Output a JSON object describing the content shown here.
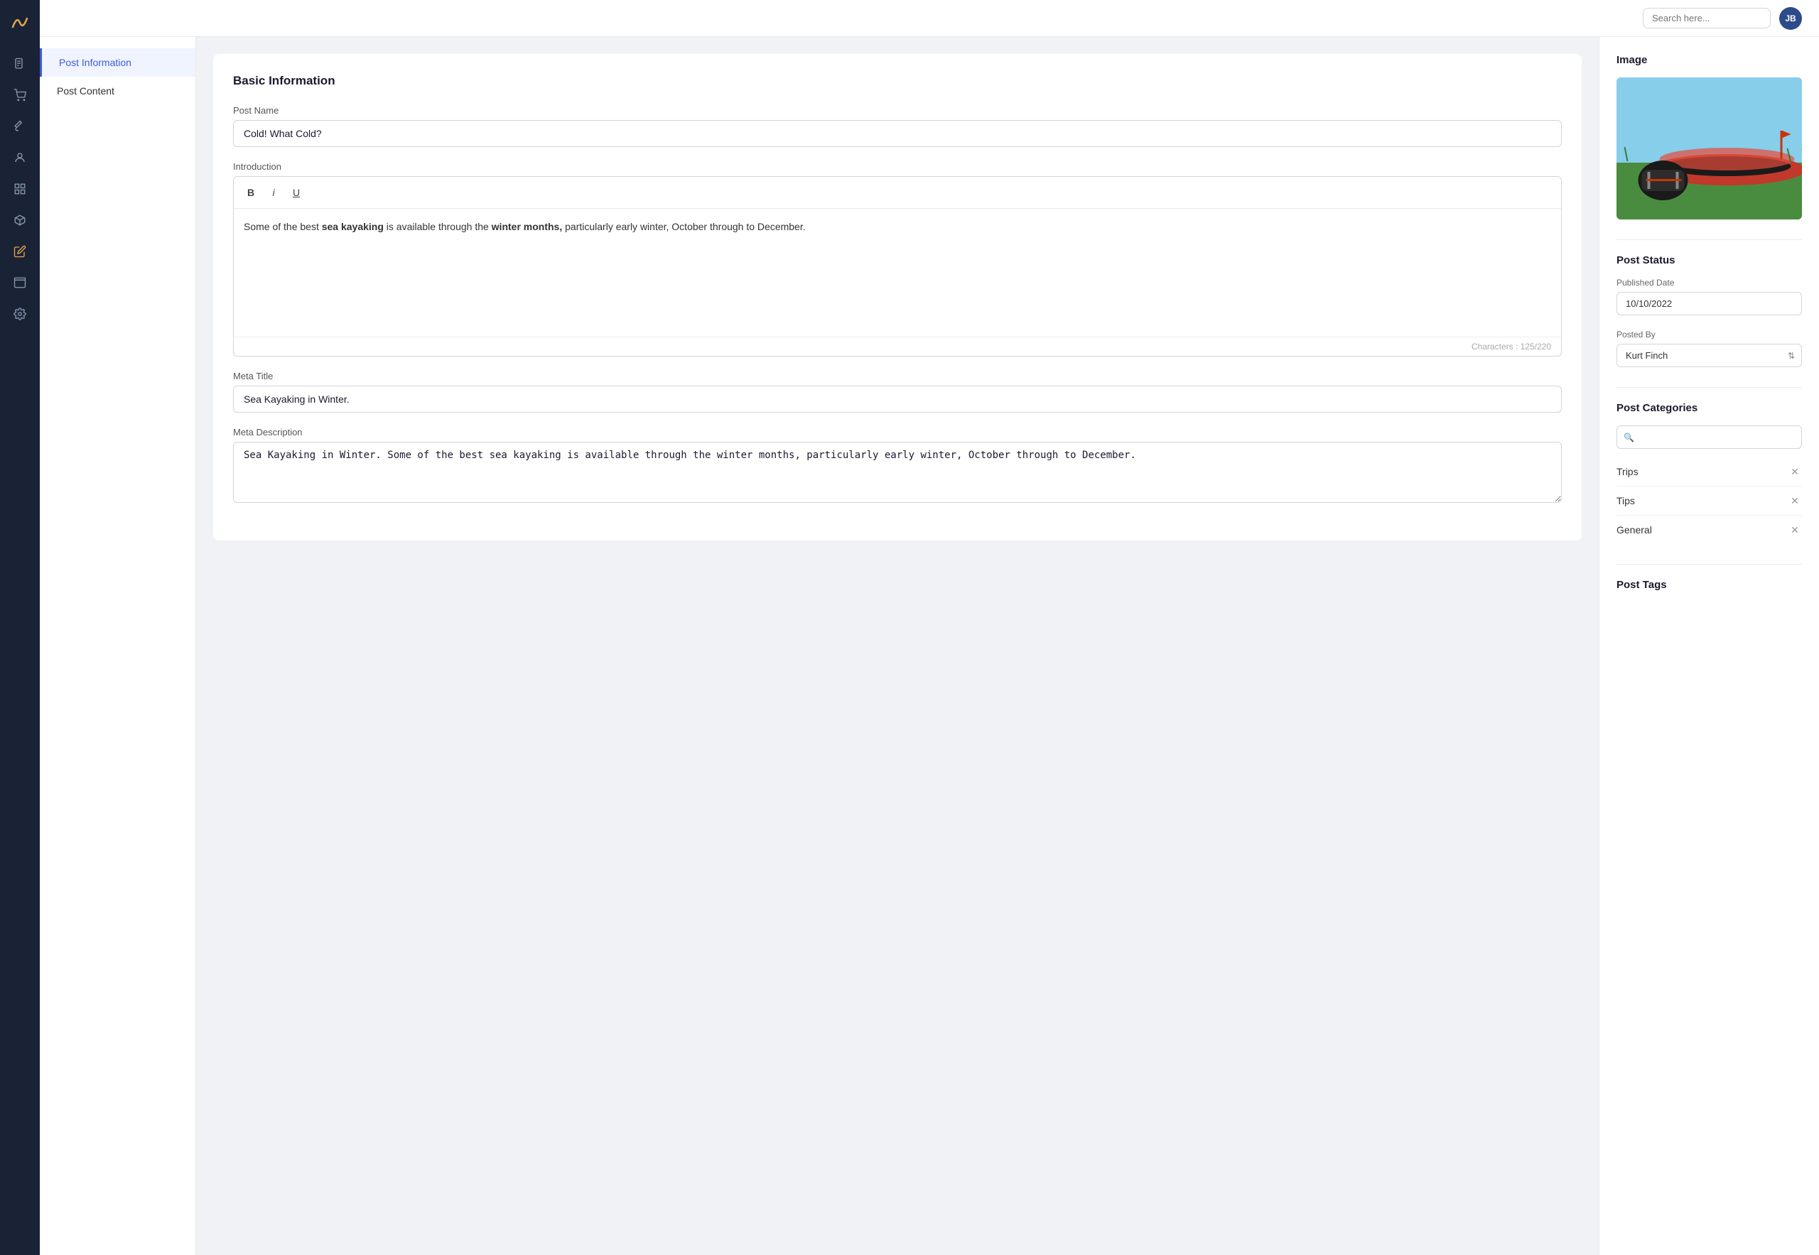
{
  "app": {
    "logo_text": "~"
  },
  "topbar": {
    "search_placeholder": "Search here...",
    "avatar_initials": "JB"
  },
  "sidebar": {
    "icons": [
      {
        "name": "document-icon",
        "symbol": "📄"
      },
      {
        "name": "cart-icon",
        "symbol": "🛒"
      },
      {
        "name": "brush-icon",
        "symbol": "🖌️"
      },
      {
        "name": "person-icon",
        "symbol": "👤"
      },
      {
        "name": "grid-icon",
        "symbol": "▦"
      },
      {
        "name": "cube-icon",
        "symbol": "◻"
      },
      {
        "name": "pencil-icon",
        "symbol": "✏️"
      },
      {
        "name": "layout-icon",
        "symbol": "▭"
      },
      {
        "name": "settings-icon",
        "symbol": "⚙️"
      }
    ]
  },
  "left_panel": {
    "items": [
      {
        "label": "Post Information",
        "active": true
      },
      {
        "label": "Post Content",
        "active": false
      }
    ]
  },
  "form": {
    "section_title": "Basic Information",
    "post_name_label": "Post Name",
    "post_name_value": "Cold! What Cold?",
    "introduction_label": "Introduction",
    "toolbar": {
      "bold_label": "B",
      "italic_label": "i",
      "underline_label": "U"
    },
    "introduction_text_part1": "Some of the best ",
    "introduction_bold1": "sea kayaking",
    "introduction_text_part2": " is available through the ",
    "introduction_bold2": "winter months,",
    "introduction_text_part3": " particularly early winter, October through to December.",
    "characters_label": "Characters : 125/220",
    "meta_title_label": "Meta Title",
    "meta_title_value": "Sea Kayaking in Winter.",
    "meta_desc_label": "Meta Description",
    "meta_desc_value": "Sea Kayaking in Winter. Some of the best sea kayaking is available through the winter months, particularly early winter, October through to December."
  },
  "right_panel": {
    "image_section_title": "Image",
    "post_status_title": "Post Status",
    "published_date_label": "Published Date",
    "published_date_value": "10/10/2022",
    "posted_by_label": "Posted By",
    "posted_by_value": "Kurt Finch",
    "categories_title": "Post Categories",
    "categories_search_placeholder": "",
    "categories": [
      {
        "name": "Trips"
      },
      {
        "name": "Tips"
      },
      {
        "name": "General"
      }
    ],
    "tags_title": "Post Tags"
  }
}
